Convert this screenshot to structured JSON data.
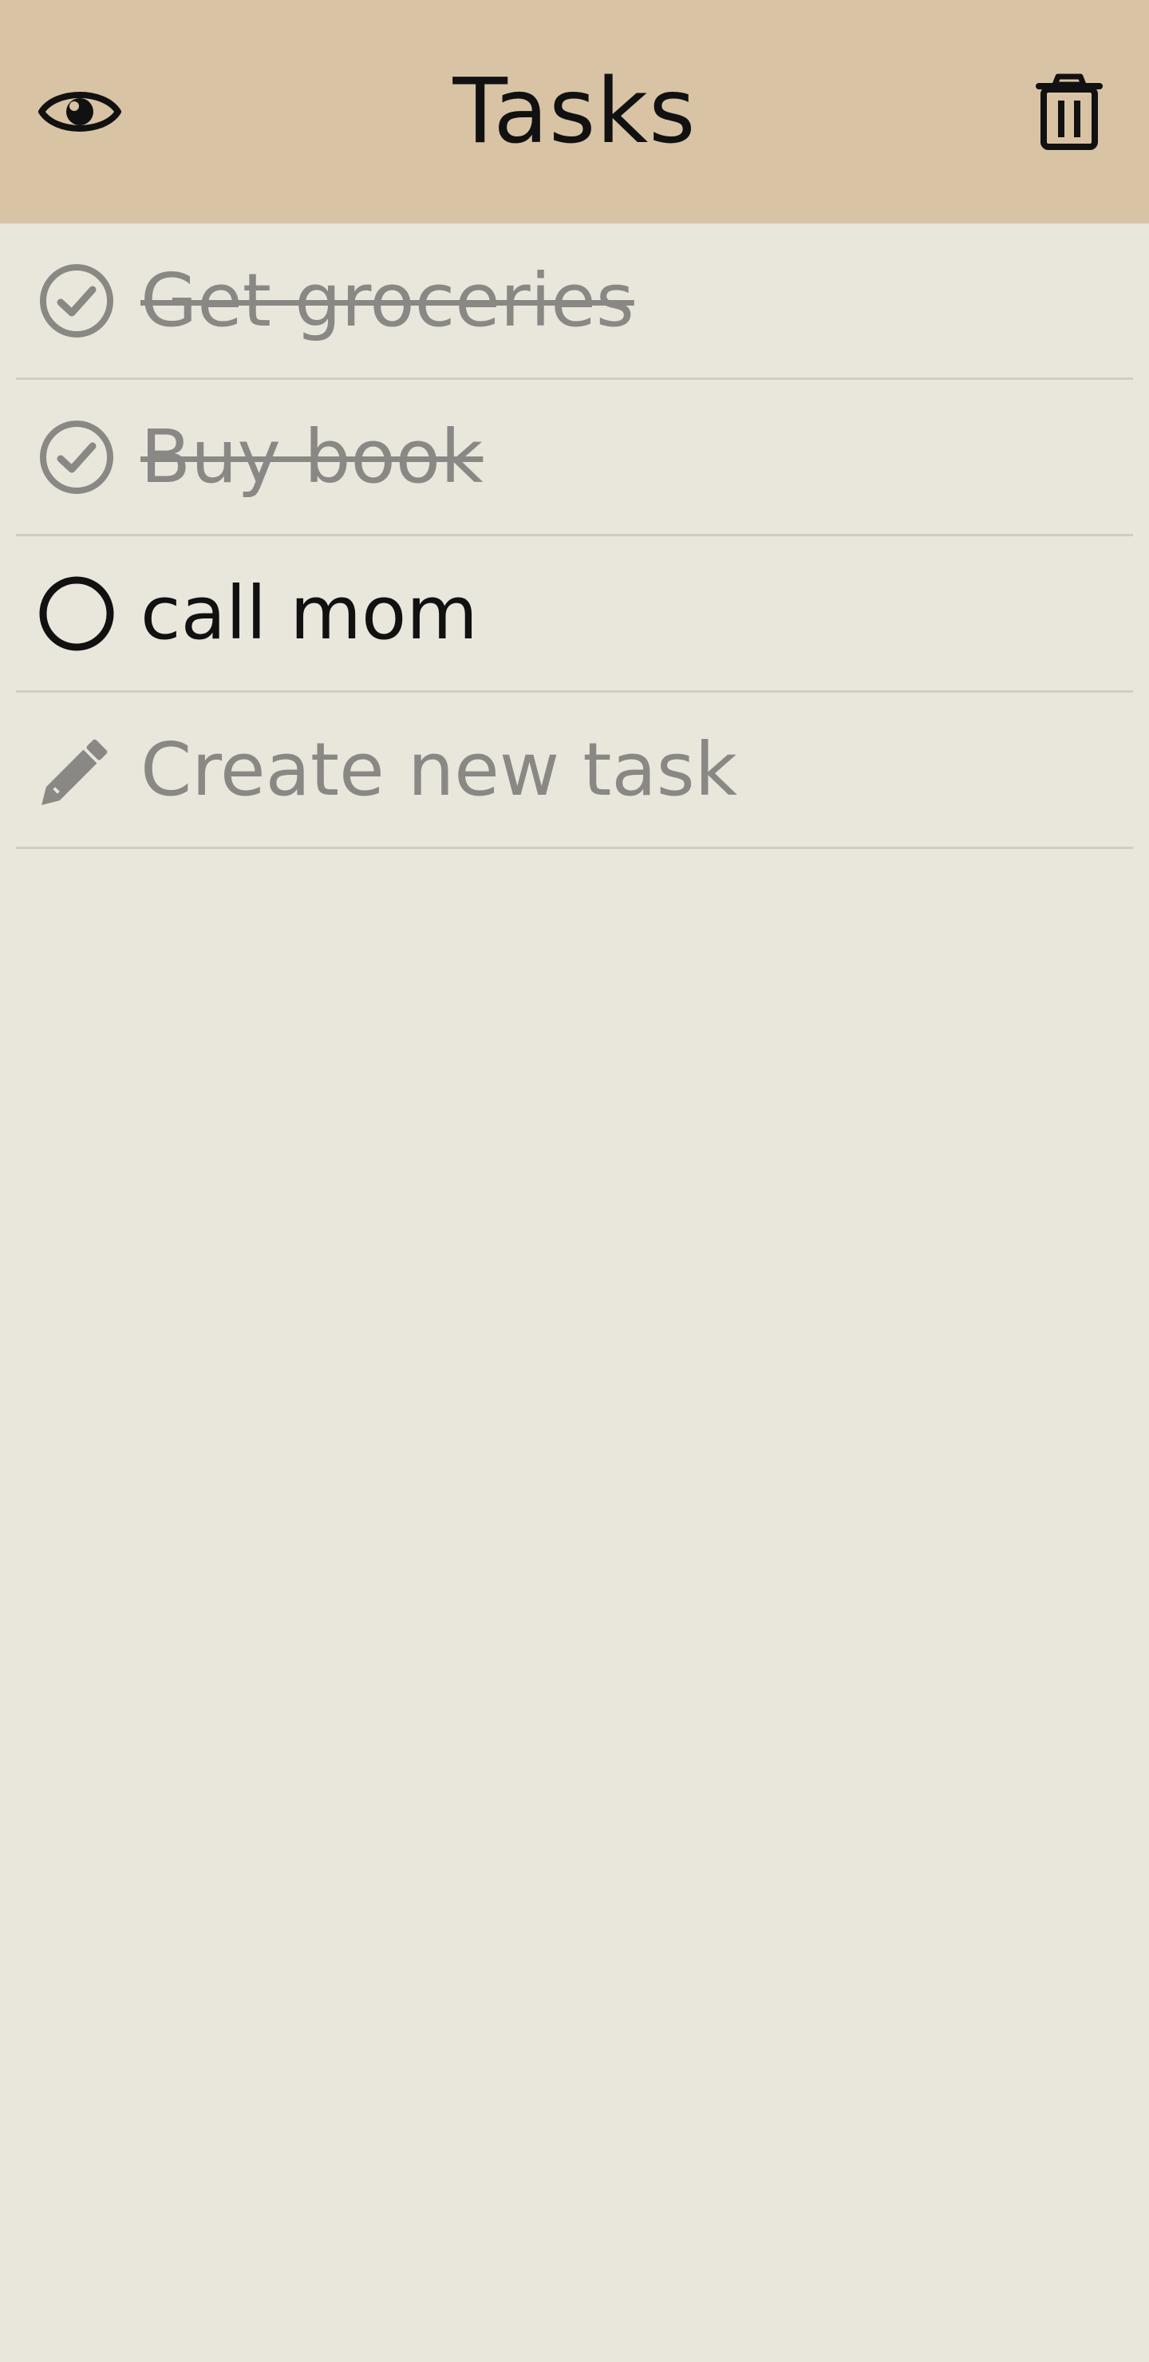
{
  "header": {
    "title": "Tasks",
    "left_icon": "eye-icon",
    "right_icon": "trash-icon"
  },
  "tasks": [
    {
      "label": "Get groceries",
      "completed": true,
      "icon": "check-circle-icon"
    },
    {
      "label": "Buy book",
      "completed": true,
      "icon": "check-circle-icon"
    },
    {
      "label": "call mom",
      "completed": false,
      "icon": "circle-icon"
    }
  ],
  "new_task": {
    "placeholder": "Create new task",
    "icon": "pencil-icon"
  },
  "colors": {
    "app_bar": "#d9c3a5",
    "background": "#e9e6dc",
    "completed_text": "#8a8885",
    "active_text": "#111111",
    "divider": "#cfcdc6"
  }
}
